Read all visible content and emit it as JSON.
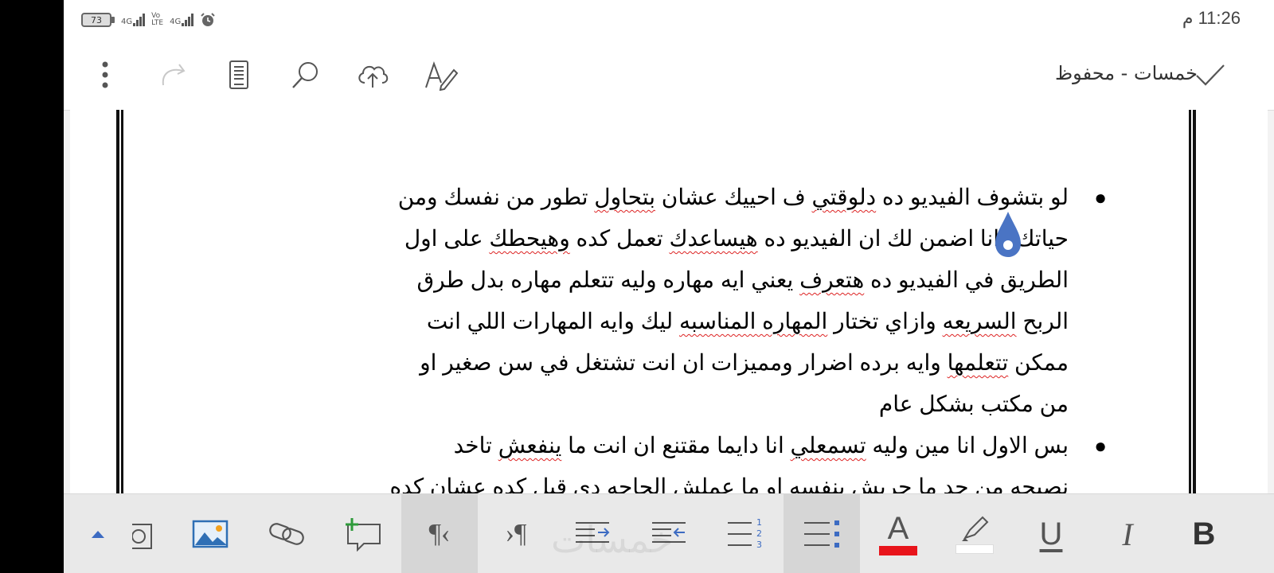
{
  "status_bar": {
    "battery": "73",
    "network1_top": "4G",
    "network2_top": "Vo",
    "network2_bottom": "LTE",
    "network3_top": "4G",
    "time": "11:26 م"
  },
  "toolbar": {
    "title": "خمسات - محفوظ",
    "icons": [
      "more-vertical-icon",
      "redo-icon",
      "reading-view-icon",
      "search-icon",
      "cloud-upload-icon",
      "draw-icon",
      "checkmark-icon"
    ]
  },
  "document": {
    "bullet1_lines": [
      [
        "لو بتشوف الفيديو ده ",
        "دلوقتي",
        " ف احييك عشان ",
        "بتحاول",
        " تطور من نفسك ومن"
      ],
      [
        "حياتك وانا اضمن لك ان الفيديو ده ",
        "هيساعدك",
        " تعمل كده ",
        "وهيحطك",
        " على اول"
      ],
      [
        "الطريق في الفيديو ده ",
        "هتعرف",
        " يعني ايه مهاره وليه تتعلم مهاره بدل طرق"
      ],
      [
        "الربح ",
        "السريعه",
        " وازاي تختار ",
        "المهاره المناسبه",
        " ليك وايه المهارات اللي انت"
      ],
      [
        "ممكن ",
        "تتعلمها",
        " وايه برده اضرار ومميزات ان انت تشتغل في سن صغير او"
      ],
      [
        "من مكتب بشكل عام"
      ]
    ],
    "bullet2_lines": [
      [
        "بس الاول انا مين وليه ",
        "تسمعلي",
        " انا دايما مقتنع ان انت ما ",
        "ينفعش",
        " تاخد"
      ],
      [
        "نصيحه من حد ما جربش بنفسه او ما عملش الحاجه دي قبل كده عشان كده"
      ]
    ],
    "bullet_char": "●"
  },
  "bottom_toolbar": {
    "bold_label": "B",
    "italic_label": "I",
    "underline_label": "U",
    "font_color_label": "A",
    "font_color": "#e8141b",
    "highlight_color": "#ffffff",
    "pilcrow_rtl": "¶‹",
    "pilcrow_ltr": "›¶",
    "watermark": "خمسات"
  }
}
